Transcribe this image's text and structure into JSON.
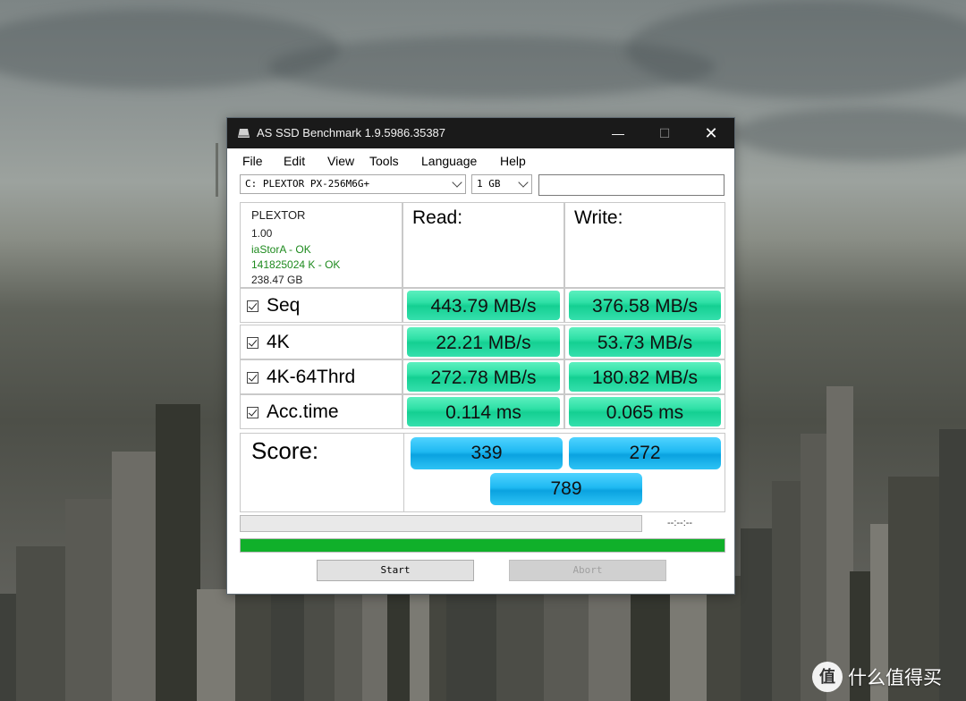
{
  "window": {
    "title": "AS SSD Benchmark 1.9.5986.35387",
    "minimize_glyph": "—",
    "maximize_glyph": "☐",
    "close_glyph": "✕"
  },
  "menu": {
    "items": [
      {
        "label": "File"
      },
      {
        "label": "Edit"
      },
      {
        "label": "View"
      },
      {
        "label": "Tools"
      },
      {
        "label": "Language"
      },
      {
        "label": "Help"
      }
    ]
  },
  "controls": {
    "drive_selected": "C: PLEXTOR PX-256M6G+",
    "size_selected": "1 GB",
    "text_field_value": ""
  },
  "drive_info": {
    "model": "PLEXTOR",
    "firmware": "1.00",
    "driver_status": "iaStorA - OK",
    "alignment_status": "141825024 K - OK",
    "capacity": "238.47 GB"
  },
  "headers": {
    "read": "Read:",
    "write": "Write:"
  },
  "results": [
    {
      "name": "Seq",
      "checked": true,
      "read": "443.79 MB/s",
      "write": "376.58 MB/s"
    },
    {
      "name": "4K",
      "checked": true,
      "read": "22.21 MB/s",
      "write": "53.73 MB/s"
    },
    {
      "name": "4K-64Thrd",
      "checked": true,
      "read": "272.78 MB/s",
      "write": "180.82 MB/s"
    },
    {
      "name": "Acc.time",
      "checked": true,
      "read": "0.114 ms",
      "write": "0.065 ms"
    }
  ],
  "score": {
    "label": "Score:",
    "read": "339",
    "write": "272",
    "total": "789"
  },
  "progress": {
    "time_text": "--:--:--",
    "test_progress": 0.0,
    "overall_progress": 1.0,
    "overall_color": "#10b02a"
  },
  "buttons": {
    "start": "Start",
    "abort": "Abort"
  },
  "watermark": {
    "icon_glyph": "值",
    "text": "什么值得买"
  },
  "colors": {
    "result_bar": "#2ee0a6",
    "score_bar": "#1fb9f2",
    "titlebar": "#1a1a1a",
    "ok_text": "#1e8a1e"
  }
}
